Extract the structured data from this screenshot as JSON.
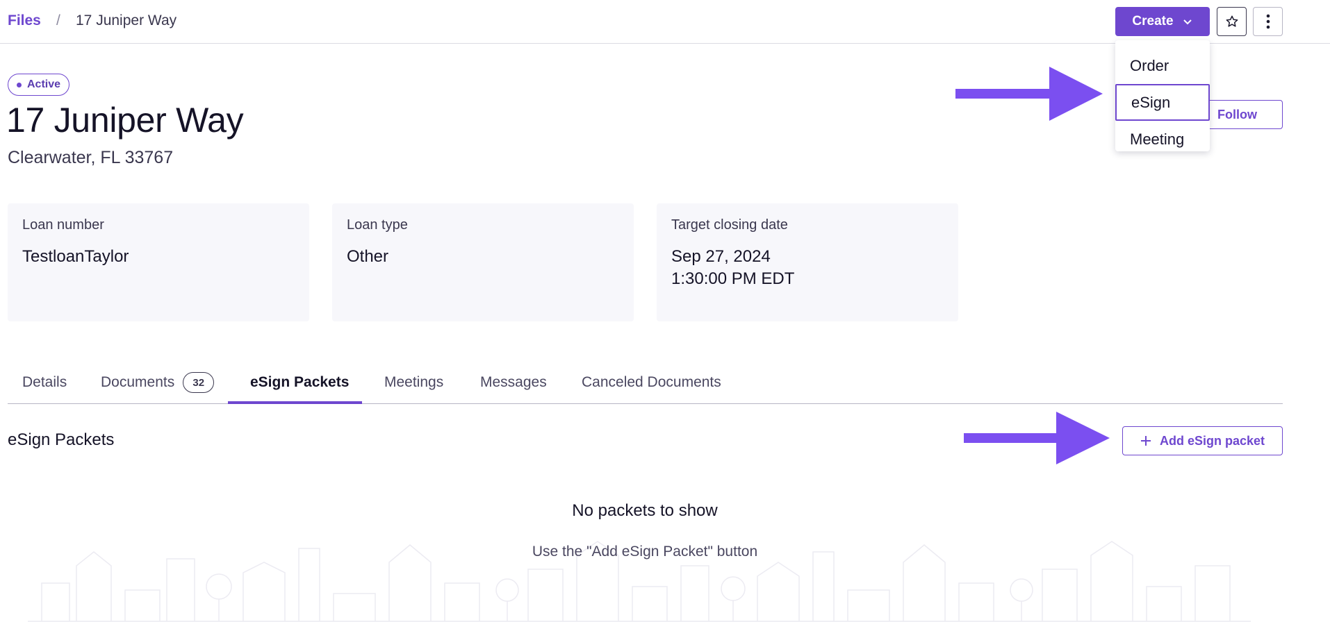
{
  "breadcrumb": {
    "root": "Files",
    "separator": "/",
    "current": "17 Juniper Way"
  },
  "header_actions": {
    "create_label": "Create",
    "star_icon": "star-icon",
    "more_icon": "more-vertical-icon"
  },
  "create_menu": {
    "items": [
      "Order",
      "eSign",
      "Meeting"
    ],
    "highlighted": "eSign"
  },
  "file": {
    "status": "Active",
    "title": "17 Juniper Way",
    "subtitle": "Clearwater, FL 33767",
    "follow_label": "Follow"
  },
  "cards": [
    {
      "label": "Loan number",
      "value": "TestloanTaylor"
    },
    {
      "label": "Loan type",
      "value": "Other"
    },
    {
      "label": "Target closing date",
      "value_line1": "Sep 27, 2024",
      "value_line2": "1:30:00 PM EDT"
    }
  ],
  "tabs": [
    {
      "label": "Details"
    },
    {
      "label": "Documents",
      "count": "32"
    },
    {
      "label": "eSign Packets",
      "active": true
    },
    {
      "label": "Meetings"
    },
    {
      "label": "Messages"
    },
    {
      "label": "Canceled Documents"
    }
  ],
  "esign_section": {
    "title": "eSign Packets",
    "add_label": "Add eSign packet",
    "empty_title": "No packets to show",
    "empty_text": "Use the \"Add eSign Packet\" button"
  },
  "colors": {
    "accent": "#6e47cf",
    "arrow": "#7b4ff0",
    "card_bg": "#f7f7fb",
    "text_dark": "#151327"
  }
}
